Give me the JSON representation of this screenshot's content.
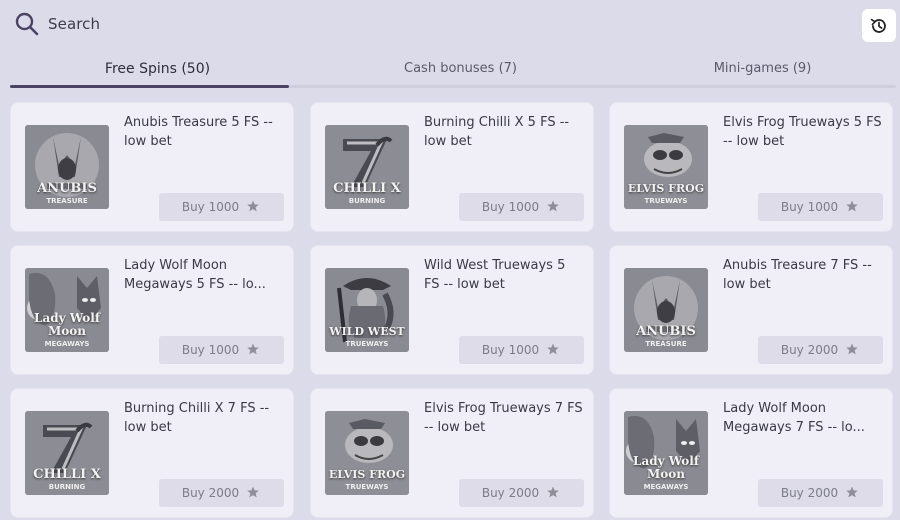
{
  "search": {
    "label": "Search",
    "icon": "search-icon"
  },
  "history": {
    "icon": "history-icon"
  },
  "tabs": [
    {
      "label": "Free Spins (50)",
      "active": true
    },
    {
      "label": "Cash bonuses (7)",
      "active": false
    },
    {
      "label": "Mini-games (9)",
      "active": false
    }
  ],
  "cards": [
    {
      "title": "Anubis Treasure 5 FS -- low bet",
      "button": "Buy 1000",
      "thumb_label": "ANUBIS",
      "thumb_sub": "TREASURE"
    },
    {
      "title": "Burning Chilli X 5 FS -- low bet",
      "button": "Buy 1000",
      "thumb_label": "CHILLI X",
      "thumb_sub": "BURNING"
    },
    {
      "title": "Elvis Frog Trueways 5 FS -- low bet",
      "button": "Buy 1000",
      "thumb_label": "ELVIS FROG",
      "thumb_sub": "TRUEWAYS"
    },
    {
      "title": "Lady Wolf Moon Megaways 5 FS -- lo...",
      "button": "Buy 1000",
      "thumb_label": "Lady Wolf Moon",
      "thumb_sub": "MEGAWAYS"
    },
    {
      "title": "Wild West Trueways 5 FS -- low bet",
      "button": "Buy 1000",
      "thumb_label": "WILD WEST",
      "thumb_sub": "TRUEWAYS"
    },
    {
      "title": "Anubis Treasure 7 FS -- low bet",
      "button": "Buy 2000",
      "thumb_label": "ANUBIS",
      "thumb_sub": "TREASURE"
    },
    {
      "title": "Burning Chilli X 7 FS -- low bet",
      "button": "Buy 2000",
      "thumb_label": "CHILLI X",
      "thumb_sub": "BURNING"
    },
    {
      "title": "Elvis Frog Trueways 7 FS -- low bet",
      "button": "Buy 2000",
      "thumb_label": "ELVIS FROG",
      "thumb_sub": "TRUEWAYS"
    },
    {
      "title": "Lady Wolf Moon Megaways 7 FS -- lo...",
      "button": "Buy 2000",
      "thumb_label": "Lady Wolf Moon",
      "thumb_sub": "MEGAWAYS"
    }
  ],
  "colors": {
    "background": "#dcdbea",
    "card": "#f0eff7",
    "accent": "#4b4362"
  }
}
